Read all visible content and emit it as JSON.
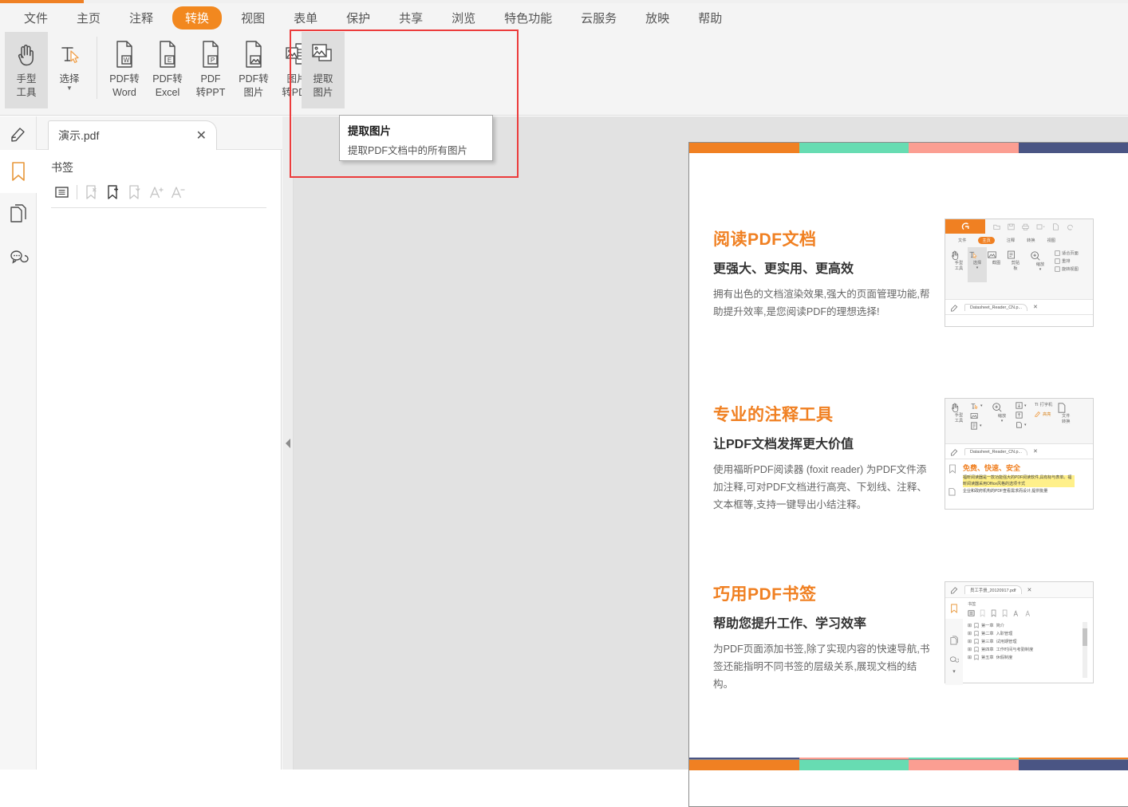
{
  "menubar": {
    "items": [
      {
        "label": "文件",
        "name": "menu-file",
        "active": false
      },
      {
        "label": "主页",
        "name": "menu-home",
        "active": false
      },
      {
        "label": "注释",
        "name": "menu-comment",
        "active": false
      },
      {
        "label": "转换",
        "name": "menu-convert",
        "active": true
      },
      {
        "label": "视图",
        "name": "menu-view",
        "active": false
      },
      {
        "label": "表单",
        "name": "menu-form",
        "active": false
      },
      {
        "label": "保护",
        "name": "menu-protect",
        "active": false
      },
      {
        "label": "共享",
        "name": "menu-share",
        "active": false
      },
      {
        "label": "浏览",
        "name": "menu-browse",
        "active": false
      },
      {
        "label": "特色功能",
        "name": "menu-features",
        "active": false
      },
      {
        "label": "云服务",
        "name": "menu-cloud",
        "active": false
      },
      {
        "label": "放映",
        "name": "menu-present",
        "active": false
      },
      {
        "label": "帮助",
        "name": "menu-help",
        "active": false
      }
    ]
  },
  "ribbon": {
    "hand_tool": {
      "line1": "手型",
      "line2": "工具",
      "icon": "hand-icon"
    },
    "select_tool": {
      "line1": "选择",
      "line2": "",
      "icon": "text-select-icon"
    },
    "buttons": [
      {
        "line1": "PDF转",
        "line2": "Word",
        "icon": "pdf-to-word-icon",
        "name": "pdf-to-word-button"
      },
      {
        "line1": "PDF转",
        "line2": "Excel",
        "icon": "pdf-to-excel-icon",
        "name": "pdf-to-excel-button"
      },
      {
        "line1": "PDF",
        "line2": "转PPT",
        "icon": "pdf-to-ppt-icon",
        "name": "pdf-to-ppt-button"
      },
      {
        "line1": "PDF转",
        "line2": "图片",
        "icon": "pdf-to-image-icon",
        "name": "pdf-to-image-button"
      },
      {
        "line1": "图片",
        "line2": "转PDF",
        "icon": "image-to-pdf-icon",
        "name": "image-to-pdf-button"
      },
      {
        "line1": "提取",
        "line2": "图片",
        "icon": "extract-image-icon",
        "name": "extract-image-button"
      }
    ]
  },
  "tooltip": {
    "title": "提取图片",
    "description": "提取PDF文档中的所有图片"
  },
  "tab": {
    "filename": "演示.pdf",
    "close": "✕"
  },
  "rail": {
    "items": [
      {
        "name": "rail-highlight-icon"
      },
      {
        "name": "rail-bookmark-icon"
      },
      {
        "name": "rail-pages-icon"
      },
      {
        "name": "rail-comments-icon"
      }
    ]
  },
  "bookmark_panel": {
    "title": "书签",
    "tools": [
      {
        "name": "bookmark-list-icon"
      },
      {
        "name": "bookmark-delete-icon"
      },
      {
        "name": "bookmark-add-icon"
      },
      {
        "name": "bookmark-options-icon"
      },
      {
        "name": "font-increase-icon"
      },
      {
        "name": "font-decrease-icon"
      }
    ]
  },
  "document": {
    "colorbar_top": [
      "#f08022",
      "#67dcb2",
      "#fb9e92",
      "#4a5584"
    ],
    "colorbar_bottom": [
      "#4a5584",
      "#fb9e92",
      "#67dcb2",
      "#f08022"
    ],
    "colorbar_page2": [
      "#f08022",
      "#67dcb2",
      "#fb9e92",
      "#4a5584"
    ],
    "sections": [
      {
        "heading": "阅读PDF文档",
        "subheading": "更强大、更实用、更高效",
        "body": "拥有出色的文档渲染效果,强大的页面管理功能,帮助提升效率,是您阅读PDF的理想选择!",
        "shot": {
          "tabname": "Datasheet_Reader_CN.p...",
          "menu": [
            "文件",
            "主页",
            "注释",
            "转换",
            "视图"
          ],
          "menu_active": "主页",
          "tools": [
            {
              "line1": "手型",
              "line2": "工具"
            },
            {
              "line1": "选择",
              "line2": ""
            },
            {
              "line1": "截图",
              "line2": ""
            },
            {
              "line1": "剪贴",
              "line2": "板"
            },
            {
              "line1": "缩放",
              "line2": ""
            }
          ],
          "side_items": [
            "适合页面",
            "重排",
            "旋转视图"
          ]
        }
      },
      {
        "heading": "专业的注释工具",
        "subheading": "让PDF文档发挥更大价值",
        "body": "使用福昕PDF阅读器 (foxit reader) 为PDF文件添加注释,可对PDF文档进行高亮、下划线、注释、文本框等,支持一键导出小结注释。",
        "shot": {
          "tabname": "Datasheet_Reader_CN.p...",
          "tools": [
            {
              "line1": "手型",
              "line2": "工具"
            },
            {
              "line1": "缩放",
              "line2": ""
            },
            {
              "line1": "打字机",
              "line2": "高亮"
            },
            {
              "line1": "文件",
              "line2": "转换"
            }
          ],
          "doc_heading": "免费、快速、安全",
          "doc_lines": [
            "福昕阅读器是一款功能强大的PDF阅读软件,具有标与表单。福昕阅读器采用Office风格的选项卡式",
            "企业和政府机构的PDF查看需求而设计,提供批量"
          ]
        }
      },
      {
        "heading": "巧用PDF书签",
        "subheading": "帮助您提升工作、学习效率",
        "body": "为PDF页面添加书签,除了实现内容的快速导航,书签还能指明不同书签的层级关系,展现文档的结构。",
        "shot": {
          "tabname": "员工手册_20120917.pdf",
          "panel_title": "书签",
          "bookmarks": [
            {
              "chapter": "第一章",
              "title": "简介"
            },
            {
              "chapter": "第二章",
              "title": "入职管理"
            },
            {
              "chapter": "第三章",
              "title": "试用期管理"
            },
            {
              "chapter": "第四章",
              "title": "工作时间与考勤制度"
            },
            {
              "chapter": "第五章",
              "title": "休假制度"
            }
          ]
        }
      }
    ]
  },
  "colors": {
    "accent": "#f08022",
    "highlight_box": "#ec3c3c",
    "menu_bg": "#f4f4f4",
    "viewer_bg": "#e2e2e2"
  }
}
